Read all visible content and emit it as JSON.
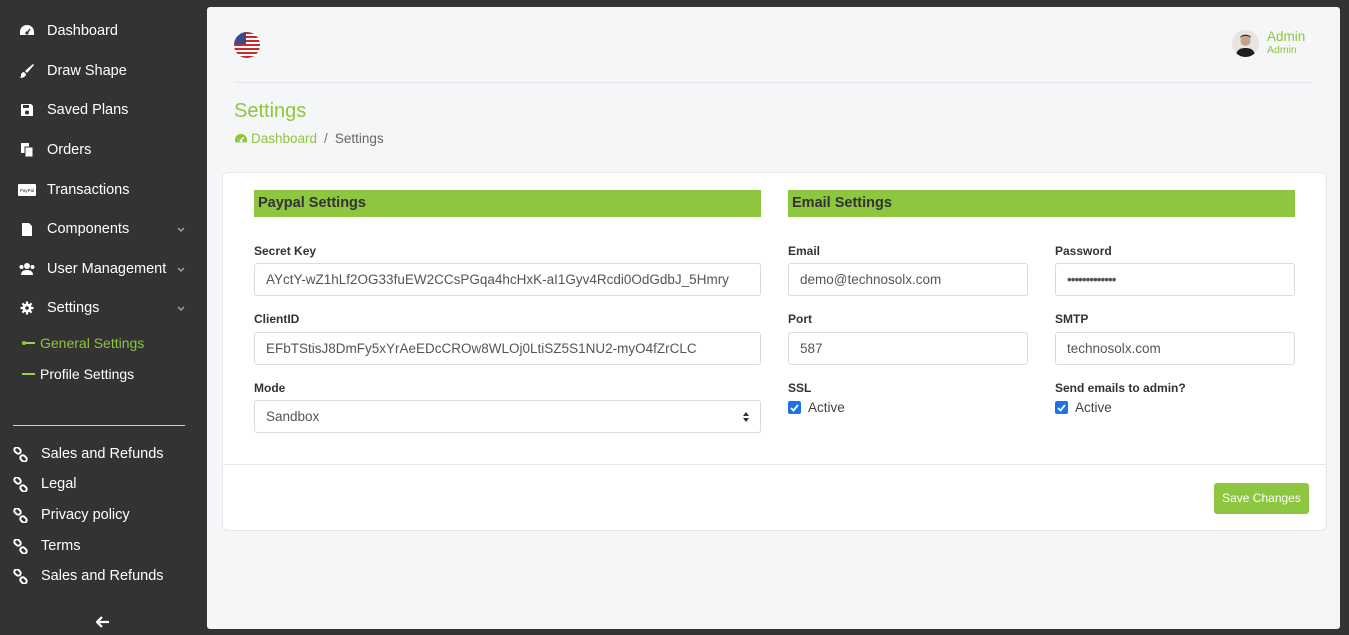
{
  "sidebar": {
    "items": [
      {
        "label": "Dashboard",
        "icon": "dashboard-icon"
      },
      {
        "label": "Draw Shape",
        "icon": "brush-icon"
      },
      {
        "label": "Saved Plans",
        "icon": "save-icon"
      },
      {
        "label": "Orders",
        "icon": "copy-icon"
      },
      {
        "label": "Transactions",
        "icon": "paypal-icon"
      },
      {
        "label": "Components",
        "icon": "file-icon"
      },
      {
        "label": "User Management",
        "icon": "users-icon"
      },
      {
        "label": "Settings",
        "icon": "gear-icon"
      }
    ],
    "subitems": [
      {
        "label": "General Settings",
        "active": true
      },
      {
        "label": "Profile Settings",
        "active": false
      }
    ],
    "links": [
      {
        "label": "Sales and Refunds"
      },
      {
        "label": "Legal"
      },
      {
        "label": "Privacy policy"
      },
      {
        "label": "Terms"
      },
      {
        "label": "Sales and Refunds"
      }
    ],
    "paypal_badge": "PayPal"
  },
  "header": {
    "user_name": "Admin",
    "user_role": "Admin"
  },
  "page": {
    "title": "Settings",
    "breadcrumb": {
      "home": "Dashboard",
      "separator": "/",
      "current": "Settings"
    }
  },
  "paypal": {
    "heading": "Paypal Settings",
    "secret_key_label": "Secret Key",
    "secret_key_value": "AYctY-wZ1hLf2OG33fuEW2CCsPGqa4hcHxK-aI1Gyv4Rcdi0OdGdbJ_5Hmry",
    "client_id_label": "ClientID",
    "client_id_value": "EFbTStisJ8DmFy5xYrAeEDcCROw8WLOj0LtiSZ5S1NU2-myO4fZrCLC",
    "mode_label": "Mode",
    "mode_value": "Sandbox"
  },
  "email": {
    "heading": "Email Settings",
    "email_label": "Email",
    "email_value": "demo@technosolx.com",
    "password_label": "Password",
    "password_value": "•••••••••••••",
    "port_label": "Port",
    "port_value": "587",
    "smtp_label": "SMTP",
    "smtp_value": "technosolx.com",
    "ssl_label": "SSL",
    "ssl_check": "Active",
    "send_label": "Send emails to admin?",
    "send_check": "Active"
  },
  "actions": {
    "save_label": "Save Changes"
  },
  "colors": {
    "accent": "#8dc63f",
    "sidebar": "#333333",
    "checkbox": "#1a73e8"
  }
}
